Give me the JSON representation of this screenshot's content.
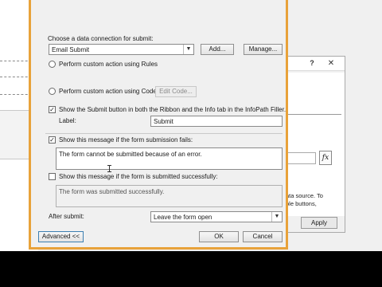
{
  "dialog": {
    "connection_label": "Choose a data connection for submit:",
    "connection_value": "Email Submit",
    "add_button": "Add...",
    "manage_button": "Manage...",
    "radio_rules_label": "Perform custom action using Rules",
    "radio_code_label": "Perform custom action using Code",
    "edit_code_button": "Edit Code...",
    "show_submit_label": "Show the Submit button in both the Ribbon and the Info tab in the InfoPath Filler.",
    "label_caption": "Label:",
    "label_value": "Submit",
    "fail_checkbox_label": "Show this message if the form submission fails:",
    "fail_message": "The form cannot be submitted because of an error.",
    "success_checkbox_label": "Show this message if the form is submitted successfully:",
    "success_message": "The form was submitted successfully.",
    "after_submit_label": "After submit:",
    "after_submit_value": "Leave the form open",
    "advanced_button": "Advanced <<",
    "ok_button": "OK",
    "cancel_button": "Cancel"
  },
  "background_dialog": {
    "help_glyph": "?",
    "close_glyph": "✕",
    "fx_label": "fx",
    "side_text_line1": "ata source. To",
    "side_text_line2": "ple buttons,",
    "side_text_line3": "",
    "apply_button": "Apply"
  },
  "state": {
    "radio_rules_selected": false,
    "radio_code_selected": false,
    "show_submit_checked": true,
    "fail_checked": true,
    "success_checked": false
  }
}
